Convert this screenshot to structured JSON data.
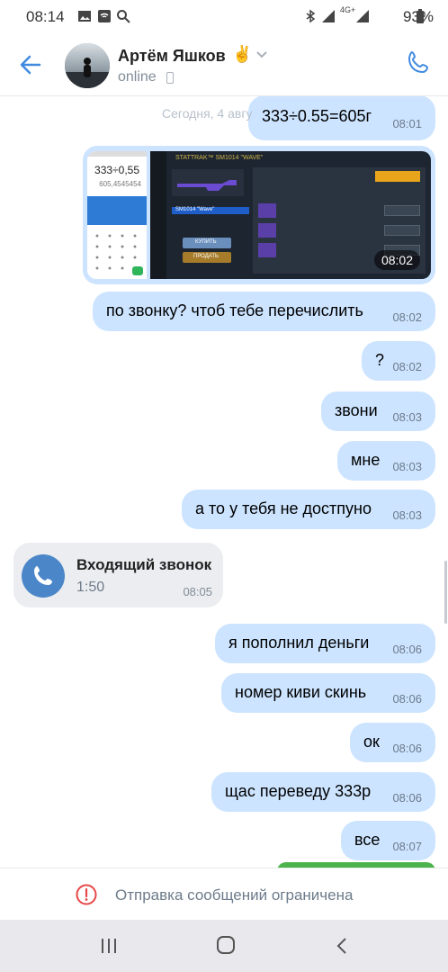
{
  "status_bar": {
    "time": "08:14",
    "battery": "93%",
    "network": "4G+"
  },
  "header": {
    "name": "Артём Яшков",
    "status": "online",
    "emoji": "✌"
  },
  "chat": {
    "date_label": "Сегодня, 4 авгу",
    "messages": [
      {
        "text": "333÷0.55=605г",
        "time": "08:01"
      },
      {
        "photo_time": "08:02"
      },
      {
        "text": "по звонку? чтоб тебе перечислить",
        "time": "08:02"
      },
      {
        "text": "?",
        "time": "08:02"
      },
      {
        "text": "звони",
        "time": "08:03"
      },
      {
        "text": "мне",
        "time": "08:03"
      },
      {
        "text": "а то у тебя не достпуно",
        "time": "08:03"
      },
      {
        "text": "я пополнил деньги",
        "time": "08:06"
      },
      {
        "text": "номер киви скинь",
        "time": "08:06"
      },
      {
        "text": "ок",
        "time": "08:06"
      },
      {
        "text": "щас переведу 333р",
        "time": "08:06"
      },
      {
        "text": "все",
        "time": "08:07"
      }
    ],
    "call": {
      "title": "Входящий звонок",
      "duration": "1:50",
      "time": "08:05"
    },
    "calc_screenshot": {
      "expression": "333÷0,55",
      "result": "605,4545454"
    },
    "game_screenshot": {
      "title": "STATTRAK™ SM1014 \"WAVE\"",
      "item_name": "SM1014 \"Wave\"",
      "buy_label": "КУПИТЬ",
      "sell_label": "ПРОДАТЬ"
    }
  },
  "footer": {
    "restriction_text": "Отправка сообщений ограничена"
  },
  "colors": {
    "bubble_out": "#cce4ff",
    "accent": "#3f8ae0",
    "call_bg": "#ebedf0"
  }
}
